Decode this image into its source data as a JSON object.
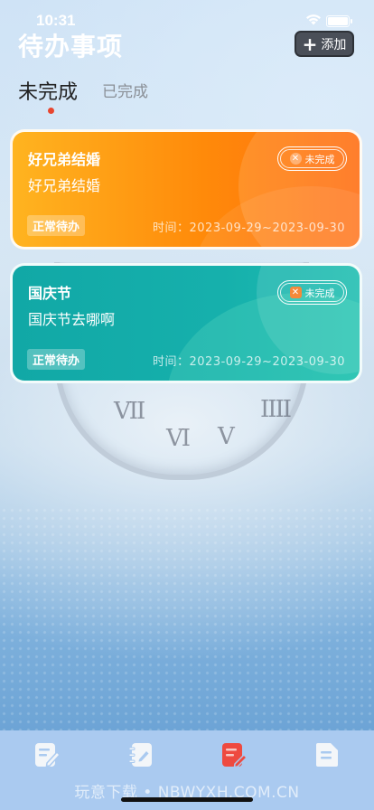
{
  "status_bar": {
    "time": "10:31"
  },
  "header": {
    "title": "待办事项",
    "add_label": "添加"
  },
  "tabs": [
    {
      "label": "未完成",
      "active": true
    },
    {
      "label": "已完成",
      "active": false
    }
  ],
  "todos": [
    {
      "title": "好兄弟结婚",
      "content": "好兄弟结婚",
      "category": "正常待办",
      "period": "时间：2023-09-29~2023-09-30",
      "status": "未完成",
      "color": "#ff8a0a"
    },
    {
      "title": "国庆节",
      "content": "国庆节去哪啊",
      "category": "正常待办",
      "period": "时间：2023-09-29~2023-09-30",
      "status": "未完成",
      "color": "#16b0ac"
    }
  ],
  "tab_bar": {
    "items": [
      {
        "icon": "edit-note-icon",
        "active": false
      },
      {
        "icon": "notebook-icon",
        "active": false
      },
      {
        "icon": "todo-list-icon",
        "active": true
      },
      {
        "icon": "document-icon",
        "active": false
      }
    ],
    "active_color": "#ee4a40",
    "inactive_color": "#f3f6f9"
  },
  "watermark": "玩意下载 • NBWYXH.COM.CN"
}
